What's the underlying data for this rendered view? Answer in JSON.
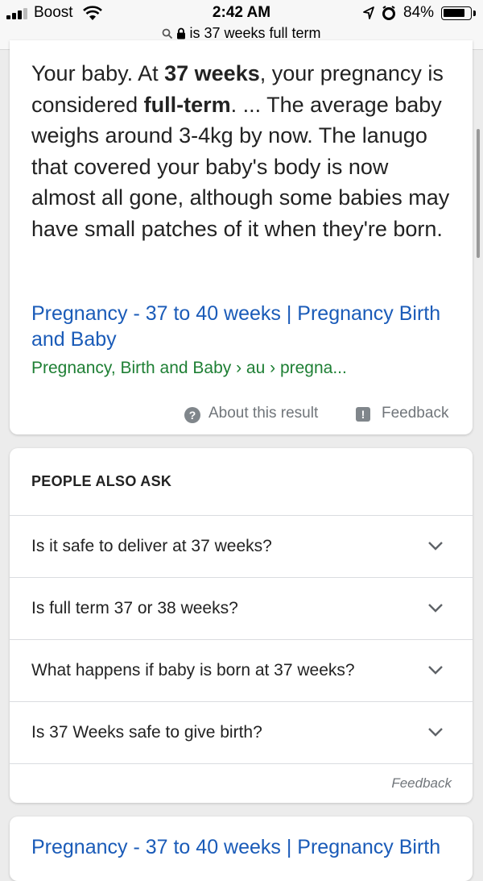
{
  "status_bar": {
    "carrier": "Boost",
    "time": "2:42 AM",
    "battery_pct": "84%",
    "battery_level": 0.84,
    "icons": [
      "signal-icon",
      "wifi-icon",
      "location-icon",
      "alarm-icon",
      "battery-icon"
    ]
  },
  "url_bar": {
    "text": "is 37 weeks full term",
    "icons": [
      "search-icon",
      "lock-icon"
    ]
  },
  "featured_snippet": {
    "p1": "Your baby. At ",
    "b1": "37 weeks",
    "p2": ", your pregnancy is considered ",
    "b2": "full-term",
    "p3": ". ... The average baby weighs around 3-4kg by now. The lanugo that covered your baby's body is now almost all gone, although some babies may have small patches of it when they're born.",
    "title": "Pregnancy - 37 to 40 weeks | Pregnancy Birth and Baby",
    "url": "Pregnancy, Birth and Baby › au › pregna...",
    "about_label": "About this result",
    "feedback_label": "Feedback"
  },
  "people_also_ask": {
    "heading": "PEOPLE ALSO ASK",
    "questions": [
      "Is it safe to deliver at 37 weeks?",
      "Is full term 37 or 38 weeks?",
      "What happens if baby is born at 37 weeks?",
      "Is 37 Weeks safe to give birth?"
    ],
    "feedback_label": "Feedback"
  },
  "next_result": {
    "title": "Pregnancy - 37 to 40 weeks | Pregnancy Birth"
  },
  "colors": {
    "link": "#1a5bb8",
    "url_green": "#1e7f34",
    "muted": "#70757a",
    "page_bg": "#ececec"
  }
}
